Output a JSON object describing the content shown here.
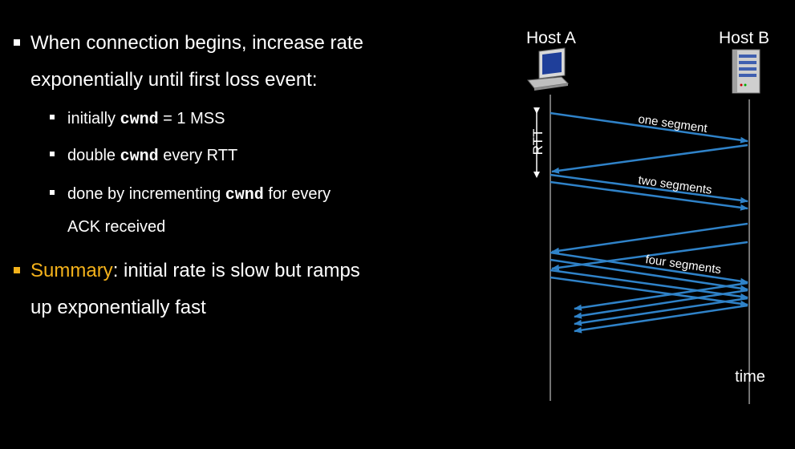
{
  "bullets": {
    "item1": {
      "line1": "When connection begins, increase rate",
      "line2": "exponentially until first loss event:"
    },
    "sub1": {
      "pre": "initially ",
      "code": "cwnd",
      "post": " = 1 MSS"
    },
    "sub2": {
      "pre": "double ",
      "code": "cwnd",
      "post": " every RTT"
    },
    "sub3": {
      "pre": "done by incrementing ",
      "code": "cwnd",
      "post": " for every",
      "line2": "ACK received"
    },
    "summary": {
      "label": "Summary",
      "colon": ":",
      "line1": " initial rate is slow but ramps",
      "line2": "up exponentially fast"
    }
  },
  "diagram": {
    "host_a": "Host A",
    "host_b": "Host B",
    "rtt_label": "RTT",
    "one_segment": "one segment",
    "two_segments": "two segments",
    "four_segments": "four segments",
    "time_label": "time",
    "arrow_color": "#2f82c8"
  },
  "colors": {
    "accent": "#f4b21b",
    "background": "#000000",
    "text": "#ffffff"
  }
}
